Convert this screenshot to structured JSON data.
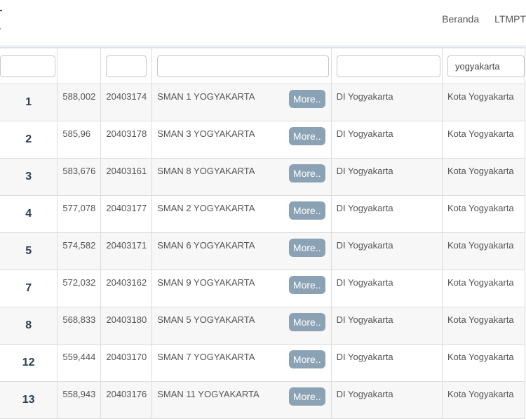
{
  "nav": {
    "items": [
      "Beranda",
      "LTMPT"
    ]
  },
  "filters": {
    "rank": "",
    "npsn": "",
    "school": "",
    "province": "",
    "city": "yogyakarta"
  },
  "rows": [
    {
      "rank": "1",
      "score": "588,002",
      "npsn": "20403174",
      "school": "SMAN 1 YOGYAKARTA",
      "more": "More..",
      "province": "DI Yogyakarta",
      "city": "Kota Yogyakarta"
    },
    {
      "rank": "2",
      "score": "585,96",
      "npsn": "20403178",
      "school": "SMAN 3 YOGYAKARTA",
      "more": "More..",
      "province": "DI Yogyakarta",
      "city": "Kota Yogyakarta"
    },
    {
      "rank": "3",
      "score": "583,676",
      "npsn": "20403161",
      "school": "SMAN 8 YOGYAKARTA",
      "more": "More..",
      "province": "DI Yogyakarta",
      "city": "Kota Yogyakarta"
    },
    {
      "rank": "4",
      "score": "577,078",
      "npsn": "20403177",
      "school": "SMAN 2 YOGYAKARTA",
      "more": "More..",
      "province": "DI Yogyakarta",
      "city": "Kota Yogyakarta"
    },
    {
      "rank": "5",
      "score": "574,582",
      "npsn": "20403171",
      "school": "SMAN 6 YOGYAKARTA",
      "more": "More..",
      "province": "DI Yogyakarta",
      "city": "Kota Yogyakarta"
    },
    {
      "rank": "7",
      "score": "572,032",
      "npsn": "20403162",
      "school": "SMAN 9 YOGYAKARTA",
      "more": "More..",
      "province": "DI Yogyakarta",
      "city": "Kota Yogyakarta"
    },
    {
      "rank": "8",
      "score": "568,833",
      "npsn": "20403180",
      "school": "SMAN 5 YOGYAKARTA",
      "more": "More..",
      "province": "DI Yogyakarta",
      "city": "Kota Yogyakarta"
    },
    {
      "rank": "12",
      "score": "559,444",
      "npsn": "20403170",
      "school": "SMAN 7 YOGYAKARTA",
      "more": "More..",
      "province": "DI Yogyakarta",
      "city": "Kota Yogyakarta"
    },
    {
      "rank": "13",
      "score": "558,943",
      "npsn": "20403176",
      "school": "SMAN 11 YOGYAKARTA",
      "more": "More..",
      "province": "DI Yogyakarta",
      "city": "Kota Yogyakarta"
    }
  ]
}
